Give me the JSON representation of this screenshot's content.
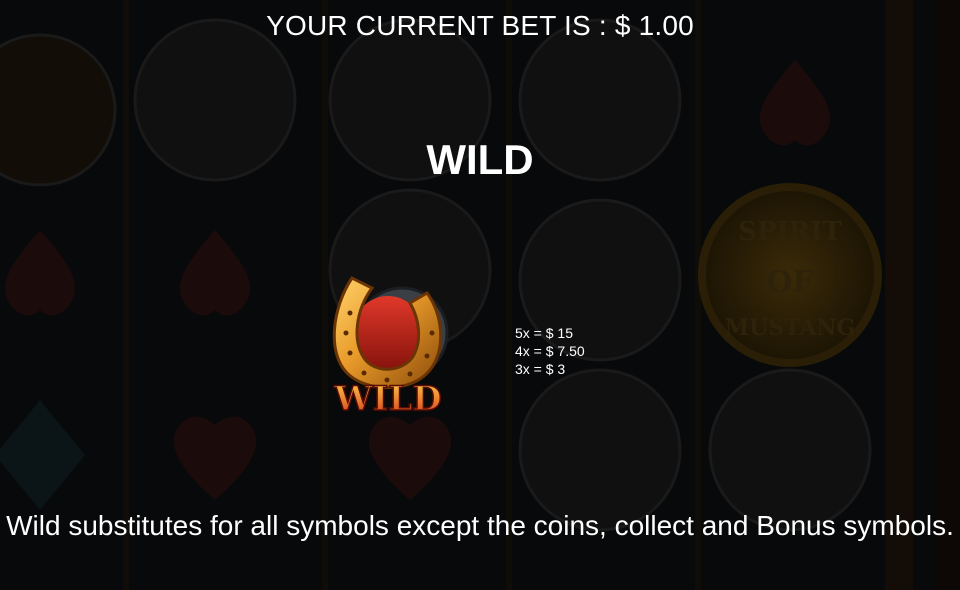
{
  "header": {
    "bet_text": "YOUR CURRENT BET IS : $ 1.00"
  },
  "section": {
    "title": "WILD"
  },
  "symbol": {
    "name": "horseshoe-wild-icon",
    "label": "WILD"
  },
  "paytable": {
    "rows": [
      {
        "text": "5x = $ 15"
      },
      {
        "text": "4x = $ 7.50"
      },
      {
        "text": "3x = $ 3"
      }
    ]
  },
  "description": {
    "text": "Wild substitutes for all symbols except the coins, collect and Bonus symbols."
  },
  "background": {
    "logo_text_top": "SPIRIT",
    "logo_text_mid": "OF",
    "logo_text_bottom": "MUSTANG"
  },
  "colors": {
    "background": "#07090a",
    "text": "#ffffff",
    "wild_gold": "#e89a2a",
    "wild_red": "#c8261a"
  }
}
